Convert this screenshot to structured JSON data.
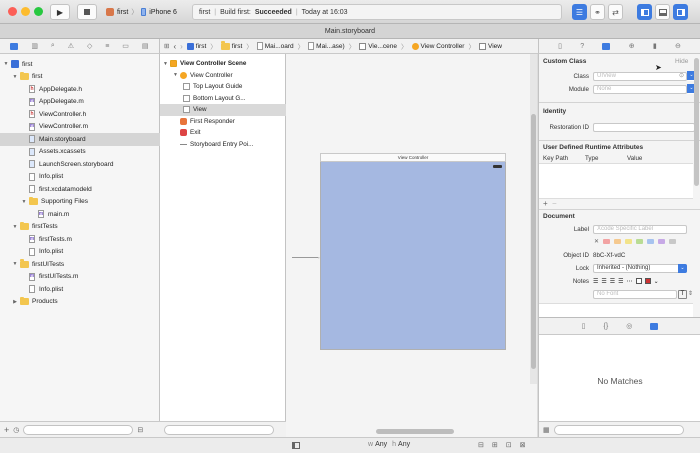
{
  "toolbar": {
    "scheme_name": "first",
    "device_name": "iPhone 6",
    "activity_project": "first",
    "activity_build_prefix": "Build first:",
    "activity_build_result": "Succeeded",
    "activity_time": "Today at 16:03"
  },
  "tab": {
    "title": "Main.storyboard"
  },
  "jumpbar": {
    "items": [
      "first",
      "first",
      "Mai...oard",
      "Mai...ase)",
      "Vie...cene",
      "View Controller",
      "View"
    ]
  },
  "navigator": {
    "items": [
      {
        "label": "first",
        "kind": "project",
        "indent": 0,
        "disclosure": "▼"
      },
      {
        "label": "first",
        "kind": "folder",
        "indent": 1,
        "disclosure": "▼"
      },
      {
        "label": "AppDelegate.h",
        "kind": "h",
        "indent": 2
      },
      {
        "label": "AppDelegate.m",
        "kind": "m",
        "indent": 2
      },
      {
        "label": "ViewController.h",
        "kind": "h",
        "indent": 2
      },
      {
        "label": "ViewController.m",
        "kind": "m",
        "indent": 2
      },
      {
        "label": "Main.storyboard",
        "kind": "storyboard",
        "indent": 2,
        "selected": true
      },
      {
        "label": "Assets.xcassets",
        "kind": "assets",
        "indent": 2
      },
      {
        "label": "LaunchScreen.storyboard",
        "kind": "storyboard",
        "indent": 2
      },
      {
        "label": "Info.plist",
        "kind": "plist",
        "indent": 2
      },
      {
        "label": "first.xcdatamodeld",
        "kind": "model",
        "indent": 2
      },
      {
        "label": "Supporting Files",
        "kind": "folder",
        "indent": 2,
        "disclosure": "▼"
      },
      {
        "label": "main.m",
        "kind": "m",
        "indent": 3
      },
      {
        "label": "firstTests",
        "kind": "folder",
        "indent": 1,
        "disclosure": "▼"
      },
      {
        "label": "firstTests.m",
        "kind": "m",
        "indent": 2
      },
      {
        "label": "Info.plist",
        "kind": "plist",
        "indent": 2
      },
      {
        "label": "firstUITests",
        "kind": "folder",
        "indent": 1,
        "disclosure": "▼"
      },
      {
        "label": "firstUITests.m",
        "kind": "m",
        "indent": 2
      },
      {
        "label": "Info.plist",
        "kind": "plist",
        "indent": 2
      },
      {
        "label": "Products",
        "kind": "folder",
        "indent": 1,
        "disclosure": "▶"
      }
    ]
  },
  "outline": {
    "items": [
      {
        "label": "View Controller Scene",
        "indent": 0,
        "bold": true,
        "icon": "scene"
      },
      {
        "label": "View Controller",
        "indent": 1,
        "icon": "vc"
      },
      {
        "label": "Top Layout Guide",
        "indent": 2,
        "icon": "guide"
      },
      {
        "label": "Bottom Layout G...",
        "indent": 2,
        "icon": "guide"
      },
      {
        "label": "View",
        "indent": 2,
        "icon": "view",
        "selected": true
      },
      {
        "label": "First Responder",
        "indent": 1,
        "icon": "responder"
      },
      {
        "label": "Exit",
        "indent": 1,
        "icon": "exit"
      },
      {
        "label": "Storyboard Entry Poi...",
        "indent": 1,
        "icon": "entry"
      }
    ]
  },
  "canvas": {
    "scene_title": "View Controller",
    "size_class_w": "Any",
    "size_class_h": "Any",
    "size_class_w_prefix": "w",
    "size_class_h_prefix": "h"
  },
  "inspector": {
    "custom_class": {
      "header": "Custom Class",
      "hide_label": "Hide",
      "class_label": "Class",
      "class_placeholder": "UIView",
      "module_label": "Module",
      "module_placeholder": "None"
    },
    "identity": {
      "header": "Identity",
      "restoration_label": "Restoration ID"
    },
    "runtime": {
      "header": "User Defined Runtime Attributes",
      "col_key_path": "Key Path",
      "col_type": "Type",
      "col_value": "Value"
    },
    "document": {
      "header": "Document",
      "label_label": "Label",
      "label_placeholder": "Xcode Specific Label",
      "object_id_label": "Object ID",
      "object_id_value": "8bC-Xf-vdC",
      "lock_label": "Lock",
      "lock_value": "Inherited - (Nothing)",
      "notes_label": "Notes",
      "font_placeholder": "No Font"
    },
    "library": {
      "empty_text": "No Matches"
    },
    "swatch_colors": [
      "#f2a3a3",
      "#f5c98f",
      "#f2e38a",
      "#b9dc94",
      "#a7c3ef",
      "#c7a9e6",
      "#c8c8c8"
    ]
  },
  "colors": {
    "accent": "#3d7be0",
    "canvas_view": "#a5b8e1"
  }
}
